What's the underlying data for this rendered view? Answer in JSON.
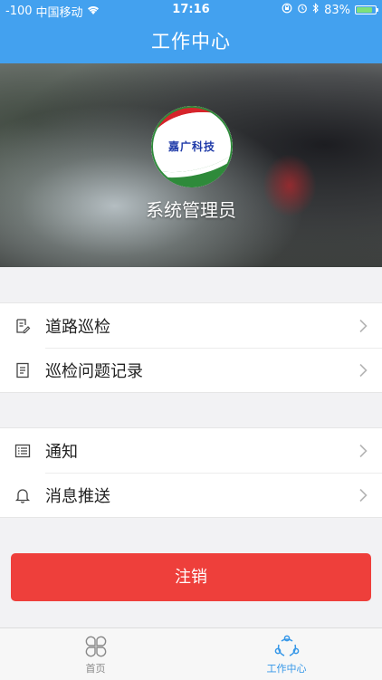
{
  "status_bar": {
    "signal": "-100",
    "carrier": "中国移动",
    "time": "17:16",
    "battery_percent": "83%",
    "battery_level": 0.83
  },
  "nav": {
    "title": "工作中心"
  },
  "profile": {
    "logo_text": "嘉广科技",
    "user_name": "系统管理员"
  },
  "menu_group_1": [
    {
      "label": "道路巡检",
      "icon": "edit-doc-icon"
    },
    {
      "label": "巡检问题记录",
      "icon": "document-icon"
    }
  ],
  "menu_group_2": [
    {
      "label": "通知",
      "icon": "list-icon"
    },
    {
      "label": "消息推送",
      "icon": "bell-icon"
    }
  ],
  "logout": {
    "label": "注销"
  },
  "tabs": [
    {
      "label": "首页",
      "icon": "clover-icon",
      "active": false
    },
    {
      "label": "工作中心",
      "icon": "share-icon",
      "active": true
    }
  ],
  "colors": {
    "primary": "#43a1ef",
    "danger": "#ee3f3b",
    "tab_active": "#3597e8"
  }
}
